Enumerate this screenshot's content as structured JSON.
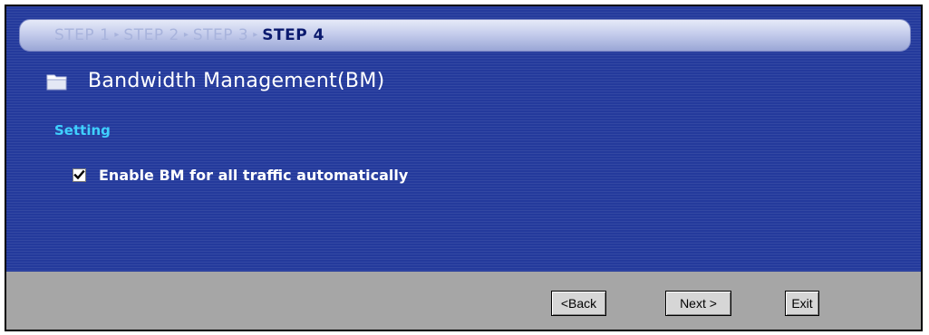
{
  "wizard": {
    "steps": [
      {
        "label": "STEP 1",
        "active": false
      },
      {
        "label": "STEP 2",
        "active": false
      },
      {
        "label": "STEP 3",
        "active": false
      },
      {
        "label": "STEP 4",
        "active": true
      }
    ],
    "step_separator": "▸"
  },
  "page": {
    "title": "Bandwidth Management(BM)",
    "title_icon": "folder-icon"
  },
  "setting": {
    "section_label": "Setting",
    "enable_bm": {
      "label": "Enable BM for all traffic automatically",
      "checked": true
    }
  },
  "footer": {
    "back_label": "<Back",
    "next_label": "Next >",
    "exit_label": "Exit"
  },
  "colors": {
    "panel_background": "#243a9c",
    "section_label": "#3fd0ff",
    "active_step": "#0b1a6e",
    "inactive_step": "#a8b3dc",
    "footer_background": "#a6a6a6"
  }
}
